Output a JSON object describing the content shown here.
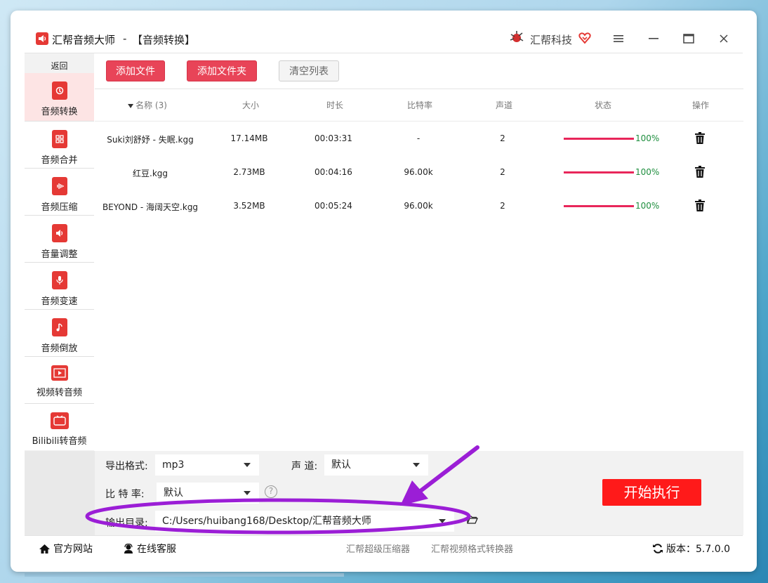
{
  "titlebar": {
    "app_name": "汇帮音频大师",
    "separator": "-",
    "mode": "【音频转换】",
    "brand": "汇帮科技"
  },
  "sidebar": {
    "back": "返回",
    "items": [
      {
        "label": "音频转换",
        "icon": "audio-convert-icon",
        "active": true
      },
      {
        "label": "音频合并",
        "icon": "audio-merge-icon"
      },
      {
        "label": "音频压缩",
        "icon": "audio-compress-icon"
      },
      {
        "label": "音量调整",
        "icon": "volume-icon"
      },
      {
        "label": "音频变速",
        "icon": "microphone-icon"
      },
      {
        "label": "音频倒放",
        "icon": "music-note-icon"
      },
      {
        "label": "视频转音频",
        "icon": "film-icon"
      },
      {
        "label": "Bilibili转音频",
        "icon": "tv-icon"
      }
    ]
  },
  "toolbar": {
    "add_file": "添加文件",
    "add_folder": "添加文件夹",
    "clear_list": "清空列表"
  },
  "table": {
    "headers": {
      "name": "名称 (3)",
      "size": "大小",
      "duration": "时长",
      "bitrate": "比特率",
      "channels": "声道",
      "status": "状态",
      "actions": "操作"
    },
    "rows": [
      {
        "name": "Suki刘舒妤 - 失眠.kgg",
        "size": "17.14MB",
        "duration": "00:03:31",
        "bitrate": "-",
        "channels": "2",
        "progress": "100%"
      },
      {
        "name": "红豆.kgg",
        "size": "2.73MB",
        "duration": "00:04:16",
        "bitrate": "96.00k",
        "channels": "2",
        "progress": "100%"
      },
      {
        "name": "BEYOND - 海阔天空.kgg",
        "size": "3.52MB",
        "duration": "00:05:24",
        "bitrate": "96.00k",
        "channels": "2",
        "progress": "100%"
      }
    ]
  },
  "settings": {
    "format_label": "导出格式:",
    "format_value": "mp3",
    "channel_label": "声 道:",
    "channel_value": "默认",
    "bitrate_label": "比 特 率:",
    "bitrate_value": "默认",
    "help": "?",
    "output_label": "输出目录:",
    "output_value": "C:/Users/huibang168/Desktop/汇帮音频大师",
    "start": "开始执行"
  },
  "footer": {
    "website": "官方网站",
    "support": "在线客服",
    "link1": "汇帮超级压缩器",
    "link2": "汇帮视频格式转换器",
    "version": "版本：5.7.0.0"
  },
  "colors": {
    "accent_red": "#e84458",
    "progress": "#e8265a",
    "start_button": "#ff1a1a",
    "annotation": "#9b1ed6"
  }
}
